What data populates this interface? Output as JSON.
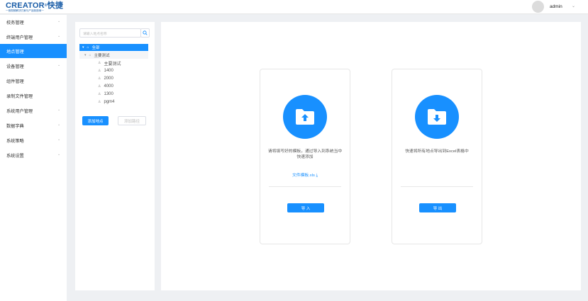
{
  "header": {
    "logo_text": "CREATOR",
    "logo_mark": "®",
    "logo_cn": "快捷",
    "logo_tagline": "一音视频解决方案与产品制造商一",
    "user_name": "admin",
    "user_caret_icon": "chevron-down-icon"
  },
  "sidebar": {
    "items": [
      {
        "label": "校务管理",
        "has_children": true
      },
      {
        "label": "终端用户管理",
        "has_children": true
      },
      {
        "label": "地点管理",
        "has_children": false,
        "active": true
      },
      {
        "label": "设备管理",
        "has_children": true
      },
      {
        "label": "组件管理",
        "has_children": false
      },
      {
        "label": "录制文件管理",
        "has_children": false
      },
      {
        "label": "系统用户管理",
        "has_children": true
      },
      {
        "label": "数据字典",
        "has_children": true
      },
      {
        "label": "系统策略",
        "has_children": true
      },
      {
        "label": "系统设置",
        "has_children": true
      }
    ],
    "chevron": "⌄"
  },
  "tree": {
    "search_placeholder": "请输入地点名称",
    "root_label": "全部",
    "group_label": "主要测试",
    "leaves": [
      "主要测试",
      "1400",
      "2000",
      "4000",
      "1300",
      "pgm4"
    ],
    "add_button": "添加地点",
    "delete_button": "添加路径"
  },
  "main": {
    "import_card": {
      "description": "请将填写好的模板，通过导入到系统当中快速添加",
      "template_link": "文件模板.xls ⤓",
      "button": "导 入",
      "icon": "folder-upload-icon"
    },
    "export_card": {
      "description": "快速将所有地点导出到Excel表格中",
      "button": "导 出",
      "icon": "folder-download-icon"
    }
  },
  "colors": {
    "accent": "#1890ff",
    "brand": "#1b5ea8",
    "background": "#eef0f3"
  }
}
